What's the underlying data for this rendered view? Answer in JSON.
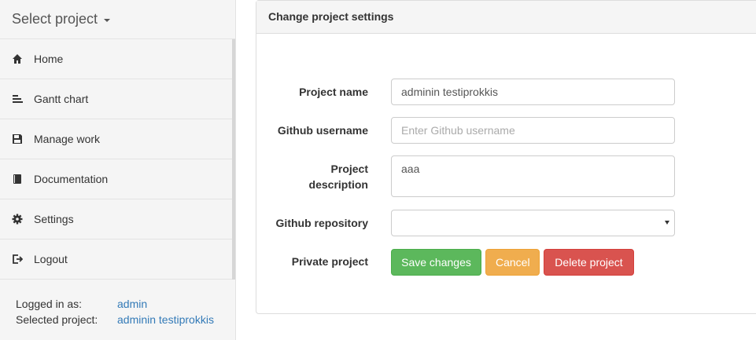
{
  "sidebar": {
    "project_selector": "Select project",
    "items": [
      {
        "label": "Home",
        "icon": "home-icon"
      },
      {
        "label": "Gantt chart",
        "icon": "gantt-icon"
      },
      {
        "label": "Manage work",
        "icon": "save-icon"
      },
      {
        "label": "Documentation",
        "icon": "book-icon"
      },
      {
        "label": "Settings",
        "icon": "gear-icon"
      },
      {
        "label": "Logout",
        "icon": "logout-icon"
      }
    ],
    "footer": {
      "logged_in_label": "Logged in as:",
      "logged_in_value": "admin",
      "selected_project_label": "Selected project:",
      "selected_project_value": "adminin testiprokkis"
    }
  },
  "panel": {
    "title": "Change project settings",
    "fields": {
      "project_name": {
        "label": "Project name",
        "value": "adminin testiprokkis"
      },
      "github_username": {
        "label": "Github username",
        "placeholder": "Enter Github username",
        "value": ""
      },
      "project_description": {
        "label_line1": "Project",
        "label_line2": "description",
        "value": "aaa"
      },
      "github_repository": {
        "label": "Github repository",
        "value": ""
      },
      "private_project": {
        "label": "Private project",
        "checked": false
      }
    },
    "buttons": {
      "save": "Save changes",
      "cancel": "Cancel",
      "delete": "Delete project"
    }
  },
  "colors": {
    "link": "#337ab7",
    "success": "#5cb85c",
    "warning": "#f0ad4e",
    "danger": "#d9534f"
  }
}
